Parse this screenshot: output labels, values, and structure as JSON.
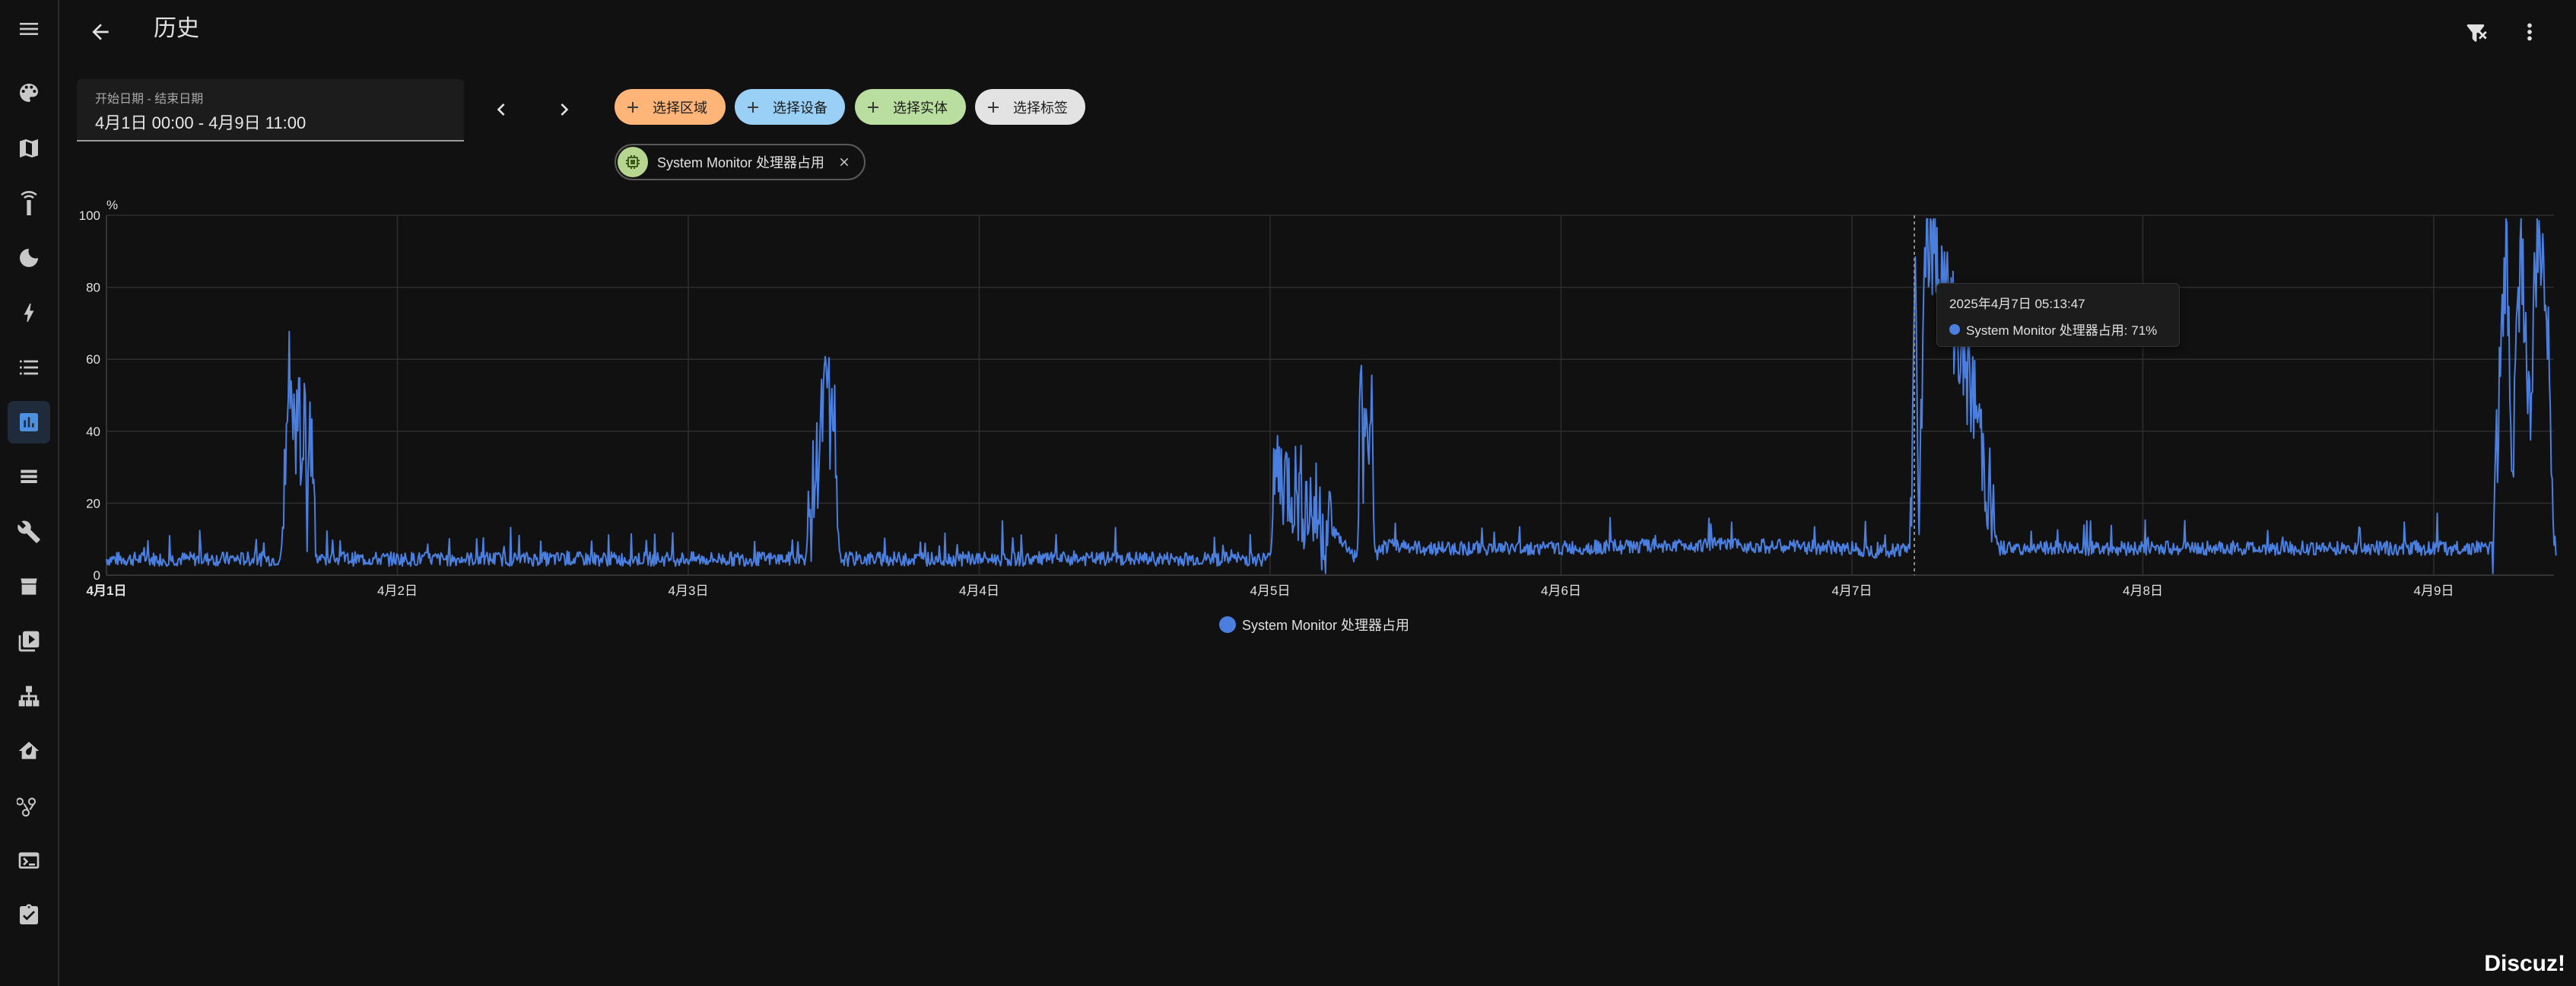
{
  "header": {
    "title": "历史",
    "back_icon": "arrow-left-icon",
    "clear_filter_icon": "filter-remove-icon",
    "more_icon": "dots-vertical-icon"
  },
  "sidebar": {
    "items": [
      {
        "name": "menu",
        "icon": "menu-icon"
      },
      {
        "name": "overview",
        "icon": "palette-icon"
      },
      {
        "name": "map",
        "icon": "map-icon"
      },
      {
        "name": "remote",
        "icon": "remote-icon"
      },
      {
        "name": "sleep",
        "icon": "moon-icon"
      },
      {
        "name": "energy",
        "icon": "lightning-icon"
      },
      {
        "name": "logbook",
        "icon": "list-icon"
      },
      {
        "name": "history",
        "icon": "chart-box-icon",
        "active": true
      },
      {
        "name": "layers",
        "icon": "layers-icon"
      },
      {
        "name": "developer",
        "icon": "wrench-icon"
      },
      {
        "name": "hacs",
        "icon": "hacs-icon"
      },
      {
        "name": "media",
        "icon": "play-box-icon"
      },
      {
        "name": "network",
        "icon": "sitemap-icon"
      },
      {
        "name": "home",
        "icon": "home-leaf-icon"
      },
      {
        "name": "nodes",
        "icon": "hub-icon"
      },
      {
        "name": "terminal",
        "icon": "console-icon"
      },
      {
        "name": "todo",
        "icon": "clipboard-icon"
      }
    ]
  },
  "date_picker": {
    "label": "开始日期 - 结束日期",
    "value": "4月1日 00:00 - 4月9日 11:00"
  },
  "target_chips": [
    {
      "label": "选择区域",
      "color": "#ffb478"
    },
    {
      "label": "选择设备",
      "color": "#9ad0f5"
    },
    {
      "label": "选择实体",
      "color": "#b9dea0"
    },
    {
      "label": "选择标签",
      "color": "#e3e3e3"
    }
  ],
  "selected_entity": {
    "name": "System Monitor 处理器占用",
    "icon": "cpu-chip-icon"
  },
  "tooltip": {
    "time": "2025年4月7日 05:13:47",
    "text": "System Monitor 处理器占用: 71%"
  },
  "legend": {
    "label": "System Monitor 处理器占用"
  },
  "watermark": "Discuz!",
  "colors": {
    "series": "#4a7fe0",
    "background": "#111111",
    "active_nav": "#4d8fe0"
  },
  "chart_data": {
    "type": "line",
    "unit": "%",
    "ylim": [
      0,
      100
    ],
    "yticks": [
      "0",
      "20",
      "40",
      "60",
      "80",
      "100"
    ],
    "xticks": [
      "4月1日",
      "4月2日",
      "4月3日",
      "4月4日",
      "4月5日",
      "4月6日",
      "4月7日",
      "4月8日",
      "4月9日"
    ],
    "grid": true,
    "legend_position": "bottom-center",
    "series": [
      {
        "name": "System Monitor 处理器占用",
        "x_days": [
          0.0,
          0.3,
          0.6,
          0.63,
          0.65,
          0.66,
          0.67,
          0.68,
          0.69,
          0.7,
          0.72,
          0.8,
          1.2,
          1.6,
          2.0,
          2.4,
          2.48,
          2.49,
          2.5,
          2.51,
          2.52,
          2.55,
          3.0,
          3.5,
          4.0,
          4.02,
          4.3,
          4.31,
          4.32,
          4.33,
          4.34,
          4.35,
          4.36,
          4.38,
          4.45,
          4.5,
          5.0,
          5.5,
          6.0,
          6.1,
          6.2,
          6.22,
          6.23,
          6.25,
          6.3,
          6.35,
          6.38,
          6.4,
          6.43,
          6.5,
          7.0,
          7.5,
          8.0,
          8.2,
          8.25,
          8.27,
          8.3,
          8.33,
          8.35,
          8.38,
          8.42
        ],
        "y": [
          4,
          4,
          4,
          60,
          35,
          58,
          30,
          55,
          20,
          48,
          4,
          4,
          4,
          4,
          4,
          4,
          55,
          35,
          52,
          20,
          4,
          4,
          4,
          4,
          4,
          30,
          4,
          55,
          25,
          57,
          30,
          50,
          4,
          7,
          8,
          7,
          7,
          8,
          7,
          6,
          7,
          90,
          10,
          95,
          85,
          71,
          60,
          55,
          45,
          7,
          7,
          7,
          7,
          7,
          92,
          30,
          95,
          40,
          85,
          90,
          5
        ]
      }
    ]
  }
}
